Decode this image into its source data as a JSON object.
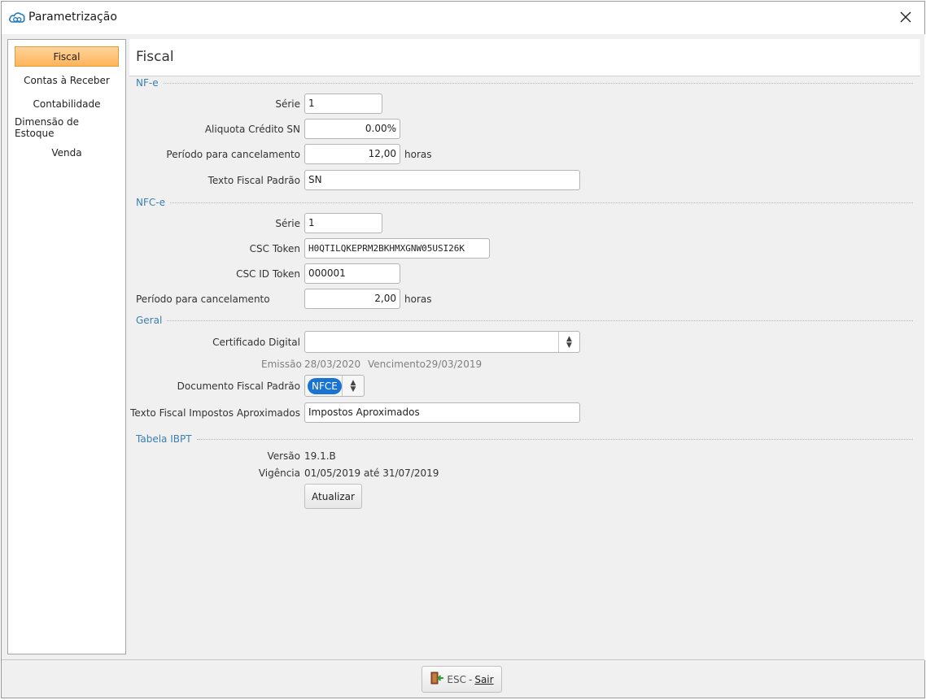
{
  "window": {
    "title": "Parametrização"
  },
  "sidebar": {
    "items": [
      {
        "label": "Fiscal",
        "active": true
      },
      {
        "label": "Contas à Receber"
      },
      {
        "label": "Contabilidade"
      },
      {
        "label": "Dimensão de Estoque"
      },
      {
        "label": "Venda"
      }
    ]
  },
  "main": {
    "title": "Fiscal",
    "nfe": {
      "section": "NF-e",
      "serie_label": "Série",
      "serie_value": "1",
      "aliquota_label": "Aliquota Crédito SN",
      "aliquota_value": "0.00%",
      "periodo_label": "Período para cancelamento",
      "periodo_value": "12,00",
      "periodo_unit": "horas",
      "texto_label": "Texto Fiscal Padrão",
      "texto_value": "SN"
    },
    "nfce": {
      "section": "NFC-e",
      "serie_label": "Série",
      "serie_value": "1",
      "csc_token_label": "CSC Token",
      "csc_token_value": "H0QTILQKEPRM2BKHMXGNW05USI26K",
      "csc_id_label": "CSC ID Token",
      "csc_id_value": "000001",
      "periodo_label": "Período para cancelamento",
      "periodo_value": "2,00",
      "periodo_unit": "horas"
    },
    "geral": {
      "section": "Geral",
      "certificado_label": "Certificado Digital",
      "certificado_value": "",
      "emissao_label": "Emissão",
      "emissao_value": "28/03/2020",
      "vencimento_label": "Vencimento",
      "vencimento_value": "29/03/2019",
      "documento_label": "Documento Fiscal Padrão",
      "documento_value": "NFCE",
      "impostos_label": "Texto Fiscal Impostos Aproximados",
      "impostos_value": "Impostos Aproximados"
    },
    "ibpt": {
      "section": "Tabela IBPT",
      "versao_label": "Versão",
      "versao_value": "19.1.B",
      "vigencia_label": "Vigência",
      "vigencia_value": "01/05/2019 até 31/07/2019",
      "atualizar_label": "Atualizar"
    }
  },
  "footer": {
    "exit_shortcut": "ESC",
    "exit_separator": "-",
    "exit_label": "Sair"
  },
  "colors": {
    "accent": "#3b7fb0",
    "active_tab": "#ffb45a",
    "chip": "#1a73d0"
  },
  "icons": [
    "cloud-logo-icon",
    "close-icon",
    "exit-door-icon",
    "spin-arrows-icon"
  ]
}
